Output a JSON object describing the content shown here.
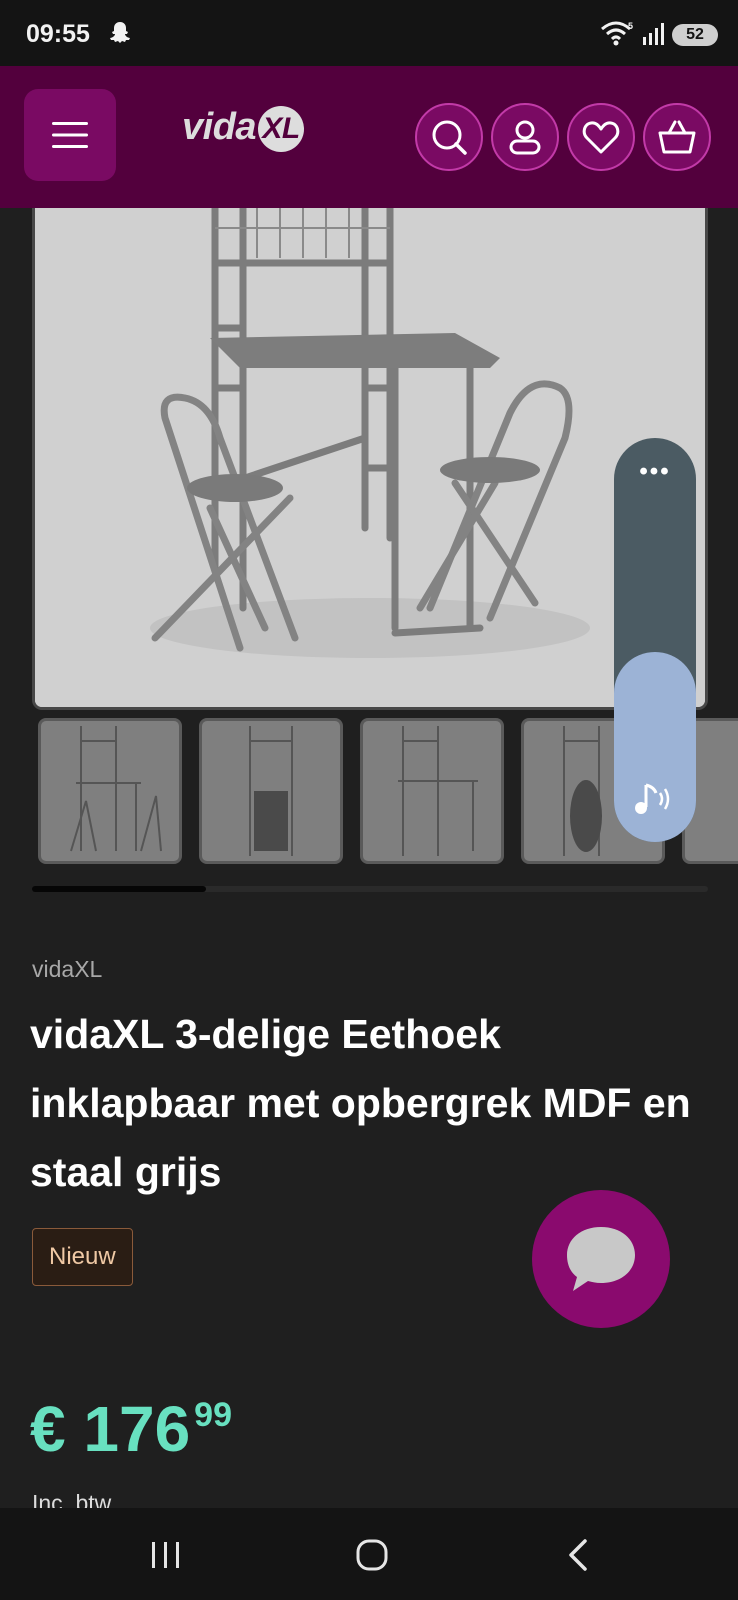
{
  "status_bar": {
    "time": "09:55",
    "battery": "52",
    "network": "5"
  },
  "header": {
    "logo": "vida",
    "logo_mark": "XL",
    "icons": [
      "menu-icon",
      "search-icon",
      "account-icon",
      "heart-icon",
      "basket-icon"
    ]
  },
  "gallery": {
    "thumbnail_count": 5
  },
  "product": {
    "brand": "vidaXL",
    "title": "vidaXL 3-delige Eethoek inklapbaar met opbergrek MDF en staal grijs",
    "badge": "Nieuw",
    "price_main": "€ 176",
    "price_cents": "99",
    "vat_text": "Inc. btw"
  },
  "colors": {
    "header_bg": "#53003d",
    "accent": "#8a0a6e",
    "price": "#68e0c0"
  }
}
